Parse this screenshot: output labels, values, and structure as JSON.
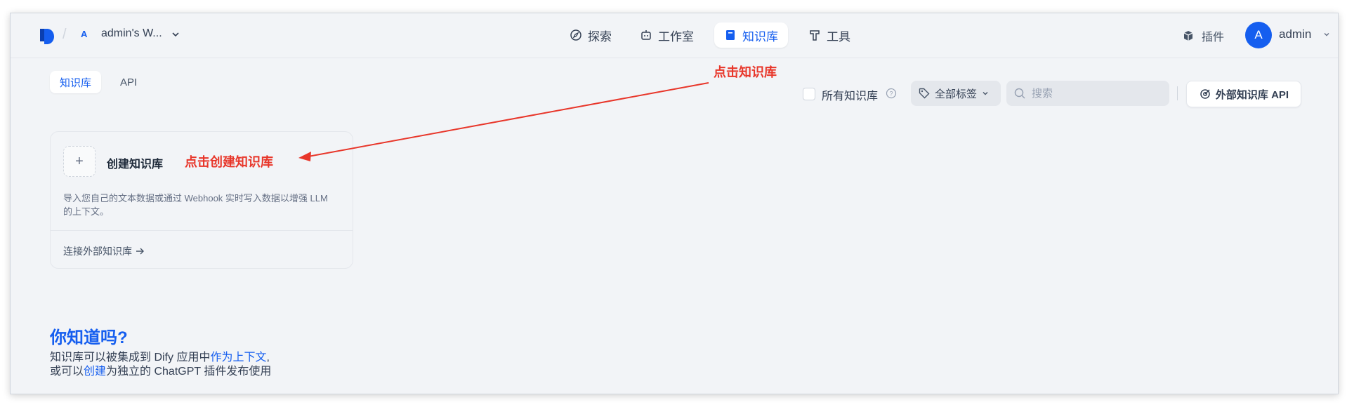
{
  "workspace": {
    "avatar_letter": "A",
    "name": "admin's W..."
  },
  "nav": {
    "explore": "探索",
    "studio": "工作室",
    "knowledge": "知识库",
    "tools": "工具"
  },
  "plugins_label": "插件",
  "user": {
    "avatar_letter": "A",
    "name": "admin"
  },
  "subtabs": {
    "knowledge": "知识库",
    "api": "API"
  },
  "filters": {
    "all_knowledge": "所有知识库",
    "all_tags": "全部标签",
    "search_placeholder": "搜索",
    "external_api": "外部知识库 API"
  },
  "create_card": {
    "plus": "+",
    "title": "创建知识库",
    "description": "导入您自己的文本数据或通过 Webhook 实时写入数据以增强 LLM 的上下文。",
    "connect_external": "连接外部知识库"
  },
  "annotations": {
    "click_knowledge": "点击知识库",
    "click_create": "点击创建知识库"
  },
  "did_you_know": {
    "title": "你知道吗?",
    "line1_a": "知识库可以被集成到 Dify 应用中",
    "line1_link": "作为上下文",
    "line1_b": ",",
    "line2_a": "或可以",
    "line2_link": "创建",
    "line2_b": "为独立的 ChatGPT 插件发布使用"
  },
  "colors": {
    "accent": "#155eef",
    "annotation": "#e8362a",
    "background": "#f2f4f7"
  }
}
